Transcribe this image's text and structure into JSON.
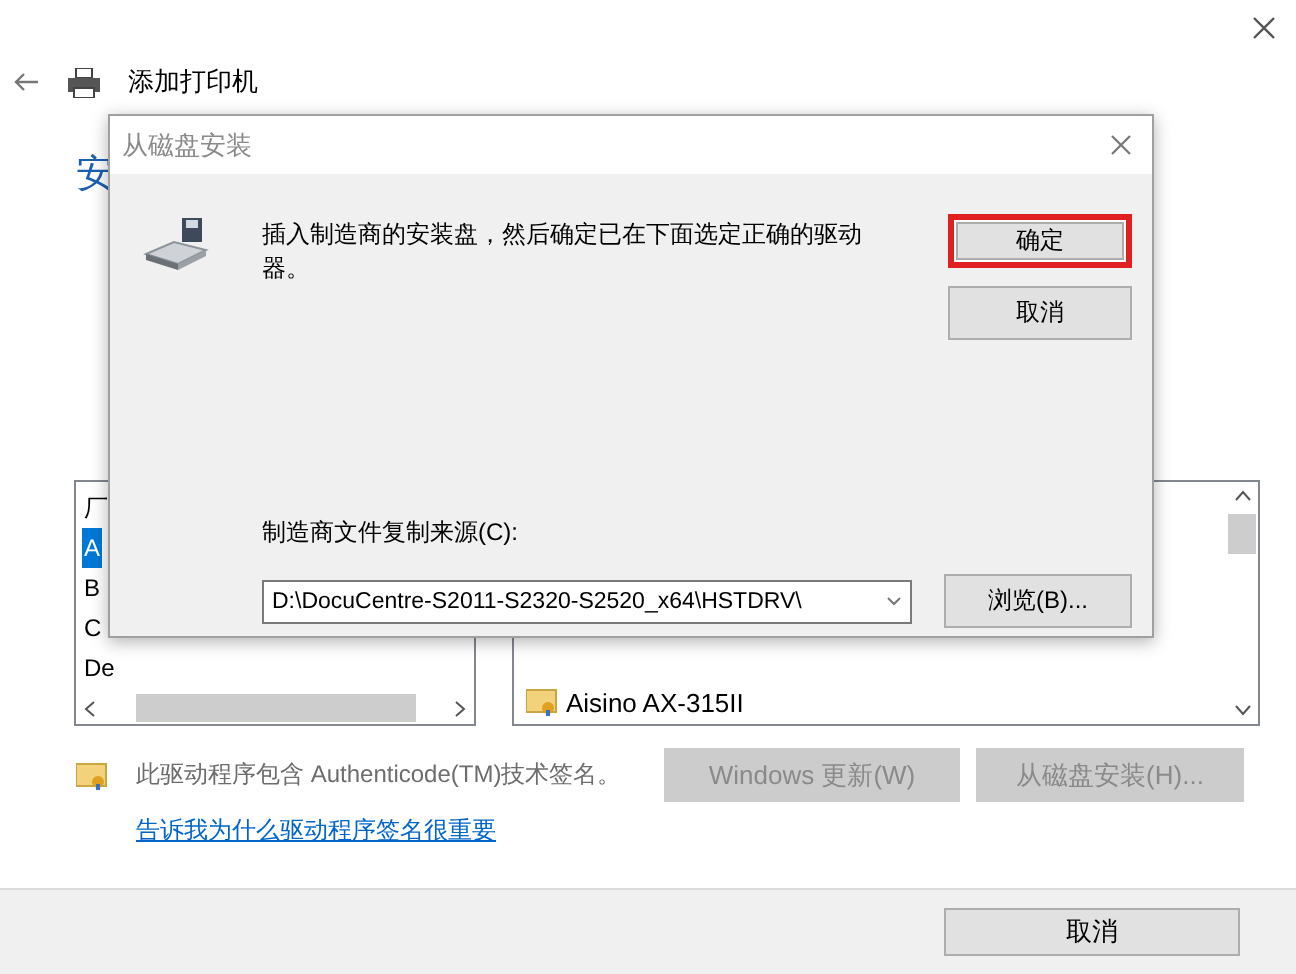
{
  "window": {
    "title": "添加打印机",
    "heading": "安"
  },
  "manufacturers": [
    {
      "label": "厂",
      "selected": false
    },
    {
      "label": "A",
      "selected": true
    },
    {
      "label": "B",
      "selected": false
    },
    {
      "label": "C",
      "selected": false
    },
    {
      "label": "De",
      "selected": false
    }
  ],
  "printers": [
    {
      "label": "Aisino AX-315II",
      "selected": false
    }
  ],
  "signature": {
    "text": "此驱动程序包含 Authenticode(TM)技术签名。",
    "link": "告诉我为什么驱动程序签名很重要"
  },
  "buttons": [
    {
      "label": "Windows 更新(W)",
      "disabled": true
    },
    {
      "label": "从磁盘安装(H)...",
      "disabled": true
    }
  ],
  "footer_buttons": [
    {
      "label": "取消",
      "disabled": false
    }
  ],
  "dialog": {
    "title": "从磁盘安装",
    "message": "插入制造商的安装盘，然后确定已在下面选定正确的驱动器。",
    "buttons": [
      {
        "label": "确定",
        "highlighted": true
      },
      {
        "label": "取消",
        "highlighted": false
      }
    ],
    "source_label": "制造商文件复制来源(C):",
    "source_value": "D:\\DocuCentre-S2011-S2320-S2520_x64\\HSTDRV\\",
    "browse": "浏览(B)..."
  }
}
